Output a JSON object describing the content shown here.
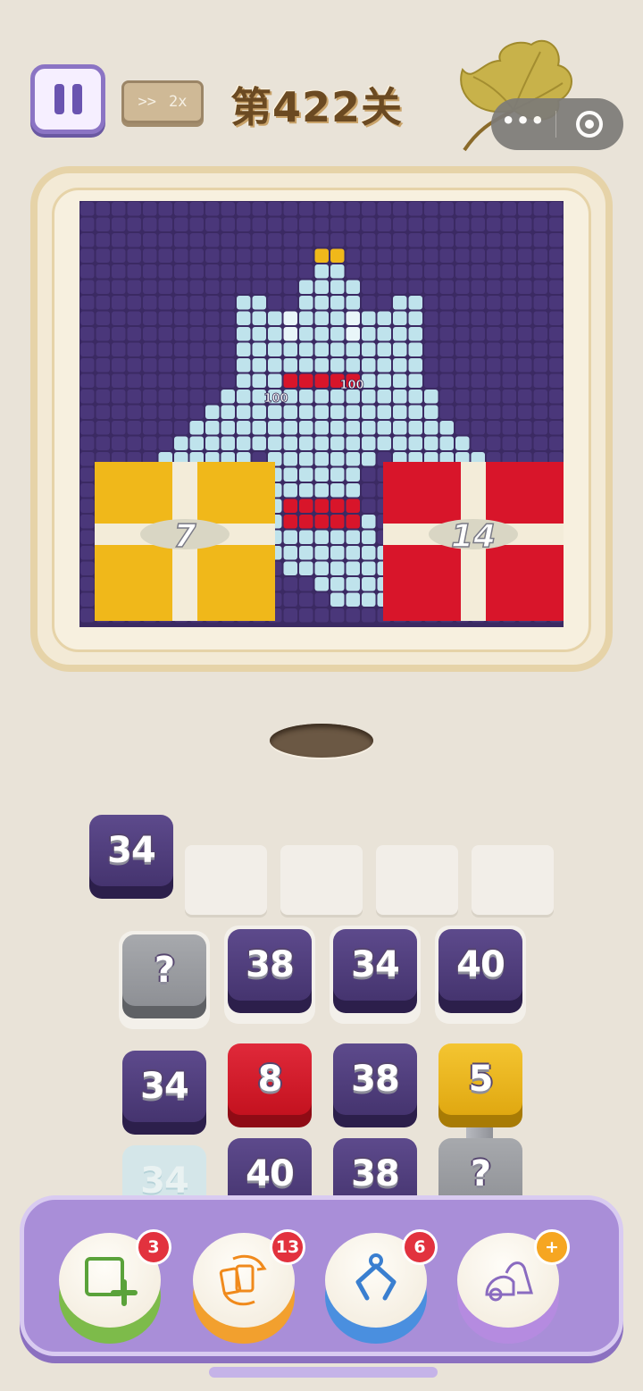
{
  "header": {
    "speed_arrows": ">>",
    "speed_label": "2x",
    "level_title": "第422关",
    "menu_dots": "•••"
  },
  "board": {
    "gifts": [
      {
        "color": "#f0b81a",
        "count": "7"
      },
      {
        "color": "#d8152a",
        "count": "14"
      }
    ],
    "score_labels": [
      "100",
      "100"
    ]
  },
  "queue": {
    "held_block": {
      "value": "34",
      "color": "purple"
    },
    "empty_slots": 4
  },
  "grid": {
    "rows": [
      [
        {
          "value": "?",
          "color": "grey"
        },
        {
          "value": "38",
          "color": "purple"
        },
        {
          "value": "34",
          "color": "purple"
        },
        {
          "value": "40",
          "color": "purple"
        }
      ],
      [
        {
          "value": "34",
          "color": "purple"
        },
        {
          "value": "8",
          "color": "red"
        },
        {
          "value": "38",
          "color": "purple"
        },
        {
          "value": "5",
          "color": "yellow"
        }
      ],
      [
        {
          "value": "34",
          "color": "ghost"
        },
        {
          "value": "40",
          "color": "purple"
        },
        {
          "value": "38",
          "color": "purple"
        },
        {
          "value": "?",
          "color": "grey"
        }
      ]
    ]
  },
  "tools": [
    {
      "icon": "add-slot-icon",
      "badge": "3",
      "rim": "#7dbb4a"
    },
    {
      "icon": "shuffle-cards-icon",
      "badge": "13",
      "rim": "#f2a02e"
    },
    {
      "icon": "claw-grab-icon",
      "badge": "6",
      "rim": "#4a8fdf"
    },
    {
      "icon": "vacuum-icon",
      "badge": "+",
      "rim": "#b58be0"
    }
  ],
  "colors": {
    "board_background": "#3b2a63",
    "genie_body": "#bfe3ec",
    "panel": "#a98ed8"
  }
}
